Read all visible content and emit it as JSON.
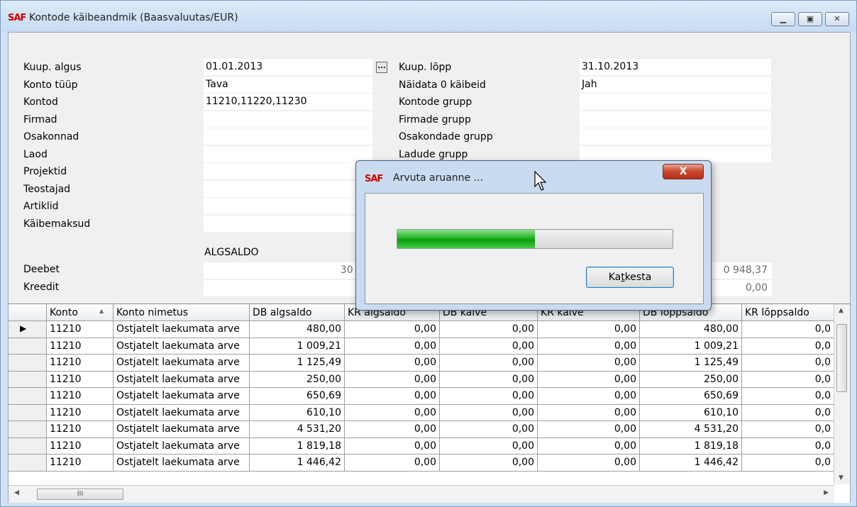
{
  "window": {
    "logo": "SAF",
    "title": "Kontode käibeandmik (Baasvaluutas/EUR)",
    "buttons": [
      "minimize",
      "maximize",
      "close"
    ]
  },
  "filters": {
    "left": [
      {
        "label": "Kuup. algus",
        "value": "01.01.2013"
      },
      {
        "label": "Konto tüüp",
        "value": "Tava"
      },
      {
        "label": "Kontod",
        "value": "11210,11220,11230"
      },
      {
        "label": "Firmad",
        "value": ""
      },
      {
        "label": "Osakonnad",
        "value": ""
      },
      {
        "label": "Laod",
        "value": ""
      },
      {
        "label": "Projektid",
        "value": ""
      },
      {
        "label": "Teostajad",
        "value": ""
      },
      {
        "label": "Artiklid",
        "value": ""
      },
      {
        "label": "Käibemaksud",
        "value": ""
      }
    ],
    "right": [
      {
        "label": "Kuup. lõpp",
        "value": "31.10.2013"
      },
      {
        "label": "Näidata 0 käibeid",
        "value": "Jah"
      },
      {
        "label": "Kontode grupp",
        "value": ""
      },
      {
        "label": "Firmade grupp",
        "value": ""
      },
      {
        "label": "Osakondade grupp",
        "value": ""
      },
      {
        "label": "Ladude grupp",
        "value": ""
      }
    ],
    "ellipsis_label": "..."
  },
  "summary": {
    "algsaldo_header": "ALGSALDO",
    "rows": [
      {
        "label": "Deebet",
        "algsaldo": "30 8",
        "loppsaldo": "0 948,37"
      },
      {
        "label": "Kreedit",
        "algsaldo": "",
        "loppsaldo": "0,00"
      }
    ]
  },
  "grid": {
    "columns": [
      "Konto",
      "Konto nimetus",
      "DB algsaldo",
      "KR algsaldo",
      "DB käive",
      "KR käive",
      "DB lõppsaldo",
      "KR lõppsaldo"
    ],
    "sort_indicator": "▲",
    "rows": [
      [
        "11210",
        "Ostjatelt laekumata arve",
        "480,00",
        "0,00",
        "0,00",
        "0,00",
        "480,00",
        "0,0"
      ],
      [
        "11210",
        "Ostjatelt laekumata arve",
        "1 009,21",
        "0,00",
        "0,00",
        "0,00",
        "1 009,21",
        "0,0"
      ],
      [
        "11210",
        "Ostjatelt laekumata arve",
        "1 125,49",
        "0,00",
        "0,00",
        "0,00",
        "1 125,49",
        "0,0"
      ],
      [
        "11210",
        "Ostjatelt laekumata arve",
        "250,00",
        "0,00",
        "0,00",
        "0,00",
        "250,00",
        "0,0"
      ],
      [
        "11210",
        "Ostjatelt laekumata arve",
        "650,69",
        "0,00",
        "0,00",
        "0,00",
        "650,69",
        "0,0"
      ],
      [
        "11210",
        "Ostjatelt laekumata arve",
        "610,10",
        "0,00",
        "0,00",
        "0,00",
        "610,10",
        "0,0"
      ],
      [
        "11210",
        "Ostjatelt laekumata arve",
        "4 531,20",
        "0,00",
        "0,00",
        "0,00",
        "4 531,20",
        "0,0"
      ],
      [
        "11210",
        "Ostjatelt laekumata arve",
        "1 819,18",
        "0,00",
        "0,00",
        "0,00",
        "1 819,18",
        "0,0"
      ],
      [
        "11210",
        "Ostjatelt laekumata arve",
        "1 446,42",
        "0,00",
        "0,00",
        "0,00",
        "1 446,42",
        "0,0"
      ]
    ],
    "current_row_marker": "▶",
    "hscroll_thumb": "III"
  },
  "dialog": {
    "logo": "SAF",
    "title": "Arvuta aruanne ...",
    "close_label": "X",
    "progress": 0.5,
    "cancel_label_pre": "Ka",
    "cancel_label_ul": "t",
    "cancel_label_post": "kesta"
  },
  "colors": {
    "progress": "#1fb51f",
    "logo": "#d40000"
  }
}
